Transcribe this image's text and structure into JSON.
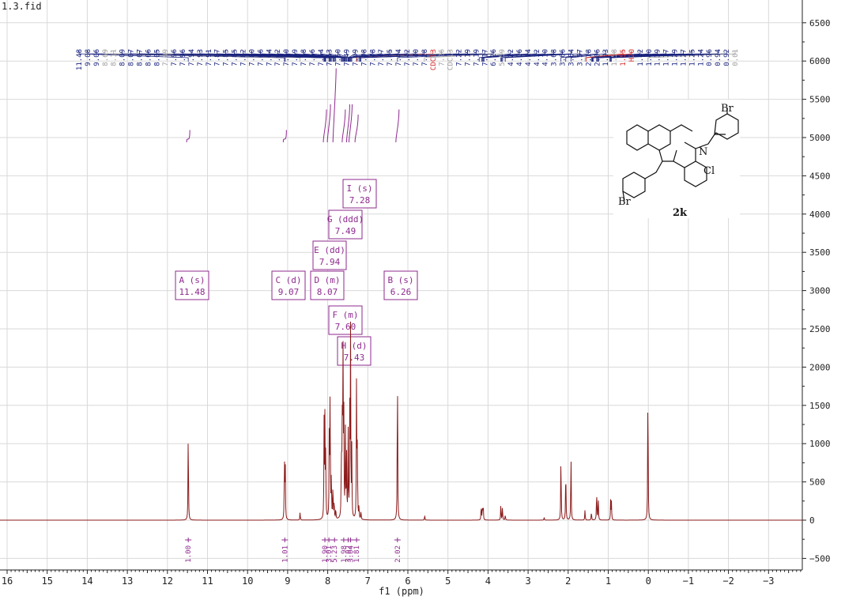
{
  "file_title": "1.3.fid",
  "chart_data": {
    "type": "line",
    "title": "1.3.fid",
    "xlabel": "f1 (ppm)",
    "ylabel": "",
    "xlim": [
      16.2,
      -3.8
    ],
    "ylim": [
      -600,
      6700
    ],
    "grid": true,
    "x_ticks": [
      "16",
      "15",
      "14",
      "13",
      "12",
      "11",
      "10",
      "9",
      "8",
      "7",
      "6",
      "5",
      "4",
      "3",
      "2",
      "1",
      "0",
      "-1",
      "-2",
      "-3"
    ],
    "y_ticks": [
      "6500",
      "6000",
      "5500",
      "5000",
      "4500",
      "4000",
      "3500",
      "3000",
      "2500",
      "2000",
      "1500",
      "1000",
      "500",
      "0",
      "-500"
    ],
    "peaks": [
      {
        "ppm": 11.48,
        "height": 1290
      },
      {
        "ppm": 9.08,
        "height": 850
      },
      {
        "ppm": 9.06,
        "height": 820
      },
      {
        "ppm": 8.69,
        "height": 110
      },
      {
        "ppm": 8.09,
        "height": 1270
      },
      {
        "ppm": 8.07,
        "height": 1300
      },
      {
        "ppm": 8.05,
        "height": 820
      },
      {
        "ppm": 7.96,
        "height": 1250
      },
      {
        "ppm": 7.94,
        "height": 1760
      },
      {
        "ppm": 7.91,
        "height": 600
      },
      {
        "ppm": 7.87,
        "height": 480
      },
      {
        "ppm": 7.84,
        "height": 260
      },
      {
        "ppm": 7.8,
        "height": 150
      },
      {
        "ppm": 7.66,
        "height": 820
      },
      {
        "ppm": 7.64,
        "height": 1400
      },
      {
        "ppm": 7.62,
        "height": 2440
      },
      {
        "ppm": 7.6,
        "height": 1500
      },
      {
        "ppm": 7.56,
        "height": 1230
      },
      {
        "ppm": 7.53,
        "height": 840
      },
      {
        "ppm": 7.49,
        "height": 1140
      },
      {
        "ppm": 7.45,
        "height": 1340
      },
      {
        "ppm": 7.43,
        "height": 2420
      },
      {
        "ppm": 7.4,
        "height": 900
      },
      {
        "ppm": 7.28,
        "height": 1980
      },
      {
        "ppm": 7.26,
        "height": 960
      },
      {
        "ppm": 7.22,
        "height": 170
      },
      {
        "ppm": 7.17,
        "height": 120
      },
      {
        "ppm": 6.26,
        "height": 2200
      },
      {
        "ppm": 5.58,
        "height": 70
      },
      {
        "ppm": 4.17,
        "height": 210
      },
      {
        "ppm": 4.14,
        "height": 180
      },
      {
        "ppm": 4.12,
        "height": 200
      },
      {
        "ppm": 3.68,
        "height": 210
      },
      {
        "ppm": 3.64,
        "height": 190
      },
      {
        "ppm": 3.57,
        "height": 80
      },
      {
        "ppm": 2.6,
        "height": 40
      },
      {
        "ppm": 2.18,
        "height": 930
      },
      {
        "ppm": 2.06,
        "height": 760
      },
      {
        "ppm": 1.93,
        "height": 950
      },
      {
        "ppm": 1.58,
        "height": 140
      },
      {
        "ppm": 1.42,
        "height": 120
      },
      {
        "ppm": 1.29,
        "height": 420
      },
      {
        "ppm": 1.25,
        "height": 330
      },
      {
        "ppm": 0.94,
        "height": 260
      },
      {
        "ppm": 0.92,
        "height": 240
      },
      {
        "ppm": 0.01,
        "height": 1970
      }
    ],
    "peak_labels": [
      {
        "text": "11.48",
        "color": "#1a237e"
      },
      {
        "text": "9.08",
        "color": "#1a237e"
      },
      {
        "text": "9.06",
        "color": "#1a237e"
      },
      {
        "text": "8.69",
        "color": "#9e9e9e"
      },
      {
        "text": "8.11",
        "color": "#9e9e9e"
      },
      {
        "text": "8.09",
        "color": "#1a237e"
      },
      {
        "text": "8.07",
        "color": "#1a237e"
      },
      {
        "text": "8.07",
        "color": "#1a237e"
      },
      {
        "text": "8.06",
        "color": "#1a237e"
      },
      {
        "text": "8.05",
        "color": "#1a237e"
      },
      {
        "text": "7.99",
        "color": "#9e9e9e"
      },
      {
        "text": "7.96",
        "color": "#1a237e"
      },
      {
        "text": "7.96",
        "color": "#1a237e"
      },
      {
        "text": "7.94",
        "color": "#1a237e"
      },
      {
        "text": "7.93",
        "color": "#1a237e"
      },
      {
        "text": "7.91",
        "color": "#1a237e"
      },
      {
        "text": "7.87",
        "color": "#1a237e"
      },
      {
        "text": "7.85",
        "color": "#1a237e"
      },
      {
        "text": "7.85",
        "color": "#1a237e"
      },
      {
        "text": "7.82",
        "color": "#1a237e"
      },
      {
        "text": "7.80",
        "color": "#1a237e"
      },
      {
        "text": "7.66",
        "color": "#1a237e"
      },
      {
        "text": "7.64",
        "color": "#1a237e"
      },
      {
        "text": "7.62",
        "color": "#1a237e"
      },
      {
        "text": "7.60",
        "color": "#1a237e"
      },
      {
        "text": "7.59",
        "color": "#1a237e"
      },
      {
        "text": "7.58",
        "color": "#1a237e"
      },
      {
        "text": "7.56",
        "color": "#1a237e"
      },
      {
        "text": "7.54",
        "color": "#1a237e"
      },
      {
        "text": "7.53",
        "color": "#1a237e"
      },
      {
        "text": "7.50",
        "color": "#1a237e"
      },
      {
        "text": "7.49",
        "color": "#1a237e"
      },
      {
        "text": "7.49",
        "color": "#1a237e"
      },
      {
        "text": "7.48",
        "color": "#1a237e"
      },
      {
        "text": "7.48",
        "color": "#1a237e"
      },
      {
        "text": "7.47",
        "color": "#1a237e"
      },
      {
        "text": "7.45",
        "color": "#1a237e"
      },
      {
        "text": "7.44",
        "color": "#1a237e"
      },
      {
        "text": "7.42",
        "color": "#1a237e"
      },
      {
        "text": "7.40",
        "color": "#1a237e"
      },
      {
        "text": "7.28",
        "color": "#1a237e"
      },
      {
        "text": "CDCl3",
        "color": "#d32f2f"
      },
      {
        "text": "7.26",
        "color": "#9e9e9e"
      },
      {
        "text": "CDCl3",
        "color": "#9e9e9e"
      },
      {
        "text": "7.22",
        "color": "#1a237e"
      },
      {
        "text": "7.19",
        "color": "#1a237e"
      },
      {
        "text": "7.19",
        "color": "#1a237e"
      },
      {
        "text": "7.17",
        "color": "#1a237e"
      },
      {
        "text": "6.26",
        "color": "#1a237e"
      },
      {
        "text": "5.59",
        "color": "#9e9e9e"
      },
      {
        "text": "4.22",
        "color": "#1a237e"
      },
      {
        "text": "4.16",
        "color": "#1a237e"
      },
      {
        "text": "4.14",
        "color": "#1a237e"
      },
      {
        "text": "4.12",
        "color": "#1a237e"
      },
      {
        "text": "4.10",
        "color": "#1a237e"
      },
      {
        "text": "3.68",
        "color": "#1a237e"
      },
      {
        "text": "3.66",
        "color": "#1a237e"
      },
      {
        "text": "3.64",
        "color": "#1a237e"
      },
      {
        "text": "3.57",
        "color": "#1a237e"
      },
      {
        "text": "2.18",
        "color": "#1a237e"
      },
      {
        "text": "2.06",
        "color": "#1a237e"
      },
      {
        "text": "1.93",
        "color": "#1a237e"
      },
      {
        "text": "1.58",
        "color": "#9e9e9e"
      },
      {
        "text": "1.55",
        "color": "#d32f2f"
      },
      {
        "text": "H2O",
        "color": "#d32f2f"
      },
      {
        "text": "1.42",
        "color": "#1a237e"
      },
      {
        "text": "1.40",
        "color": "#1a237e"
      },
      {
        "text": "1.39",
        "color": "#1a237e"
      },
      {
        "text": "1.37",
        "color": "#1a237e"
      },
      {
        "text": "1.29",
        "color": "#1a237e"
      },
      {
        "text": "1.27",
        "color": "#1a237e"
      },
      {
        "text": "1.25",
        "color": "#1a237e"
      },
      {
        "text": "1.24",
        "color": "#1a237e"
      },
      {
        "text": "0.96",
        "color": "#1a237e"
      },
      {
        "text": "0.94",
        "color": "#1a237e"
      },
      {
        "text": "0.92",
        "color": "#1a237e"
      },
      {
        "text": "0.01",
        "color": "#9e9e9e"
      }
    ],
    "multiplets": [
      {
        "letter": "A",
        "type": "s",
        "shift": "11.48",
        "ppm": 11.48
      },
      {
        "letter": "C",
        "type": "d",
        "shift": "9.07",
        "ppm": 9.07
      },
      {
        "letter": "D",
        "type": "m",
        "shift": "8.07",
        "ppm": 8.07
      },
      {
        "letter": "E",
        "type": "dd",
        "shift": "7.94",
        "ppm": 7.94
      },
      {
        "letter": "F",
        "type": "m",
        "shift": "7.60",
        "ppm": 7.6
      },
      {
        "letter": "G",
        "type": "ddd",
        "shift": "7.49",
        "ppm": 7.49
      },
      {
        "letter": "H",
        "type": "d",
        "shift": "7.43",
        "ppm": 7.43
      },
      {
        "letter": "I",
        "type": "s",
        "shift": "7.28",
        "ppm": 7.28
      },
      {
        "letter": "B",
        "type": "s",
        "shift": "6.26",
        "ppm": 6.26
      }
    ],
    "integrals": [
      {
        "ppm": 11.48,
        "value": "1.00",
        "rise": 0.35
      },
      {
        "ppm": 9.07,
        "value": "1.01",
        "rise": 0.35
      },
      {
        "ppm": 8.07,
        "value": "1.90",
        "rise": 0.55
      },
      {
        "ppm": 7.97,
        "value": "3.01",
        "rise": 0.6
      },
      {
        "ppm": 7.83,
        "value": "5.23",
        "rise": 0.95
      },
      {
        "ppm": 7.6,
        "value": "1.98",
        "rise": 0.55
      },
      {
        "ppm": 7.49,
        "value": "3.02",
        "rise": 0.6
      },
      {
        "ppm": 7.43,
        "value": "3.04",
        "rise": 0.6
      },
      {
        "ppm": 7.28,
        "value": "1.81",
        "rise": 0.5
      },
      {
        "ppm": 6.26,
        "value": "2.02",
        "rise": 0.55
      }
    ],
    "structure": {
      "compound_label": "2k",
      "atom_labels": [
        "Br",
        "N",
        "Cl",
        "Br"
      ]
    },
    "colors": {
      "spectrum": "#8b1a1a",
      "peak_pick": "#1a237e",
      "multiplet": "#8e2a8e",
      "integral": "#8e2a8e",
      "grid": "#d9d9d9"
    }
  }
}
